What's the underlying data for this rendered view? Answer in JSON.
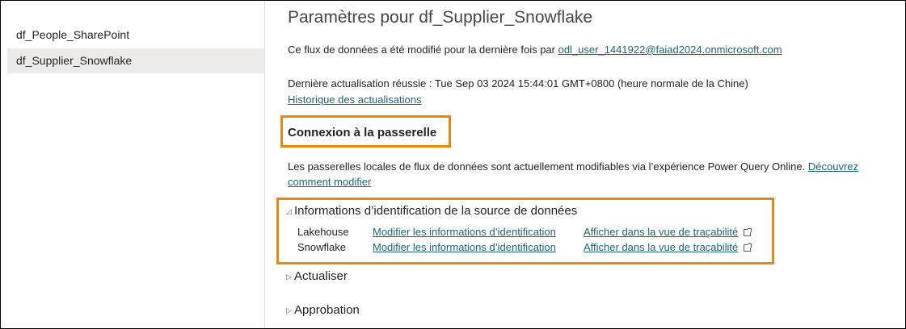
{
  "sidebar": {
    "items": [
      {
        "label": "df_People_SharePoint",
        "selected": false
      },
      {
        "label": "df_Supplier_Snowflake",
        "selected": true
      }
    ]
  },
  "main": {
    "title": "Paramètres pour df_Supplier_Snowflake",
    "modified_prefix": "Ce flux de données a été modifié pour la dernière fois par ",
    "modified_user": "odl_user_1441922@faiad2024.onmicrosoft.com",
    "last_refresh": "Dernière actualisation réussie : Tue Sep 03 2024 15:44:01 GMT+0800 (heure normale de la Chine)",
    "refresh_history_link": "Historique des actualisations",
    "gateway": {
      "heading": "Connexion à la passerelle",
      "text": "Les passerelles locales de flux de données sont actuellement modifiables via l’expérience Power Query Online. ",
      "link_part1": "Découvrez",
      "link_part2": "comment modifier"
    },
    "credentials": {
      "heading": "Informations d’identification de la source de données",
      "expanded_glyph": "◿",
      "rows": [
        {
          "source": "Lakehouse",
          "edit_link": "Modifier les informations d’identification",
          "lineage_link": "Afficher dans la vue de traçabilité"
        },
        {
          "source": "Snowflake",
          "edit_link": "Modifier les informations d’identification",
          "lineage_link": "Afficher dans la vue de traçabilité"
        }
      ]
    },
    "sections": [
      {
        "label": "Actualiser",
        "glyph": "▷"
      },
      {
        "label": "Approbation",
        "glyph": "▷"
      }
    ]
  },
  "colors": {
    "highlight": "#e8860f",
    "link": "#1d6577",
    "selected_bg": "#edebe9"
  },
  "icons": [
    "external-link-icon",
    "expand-triangle-icon",
    "collapse-triangle-icon"
  ]
}
